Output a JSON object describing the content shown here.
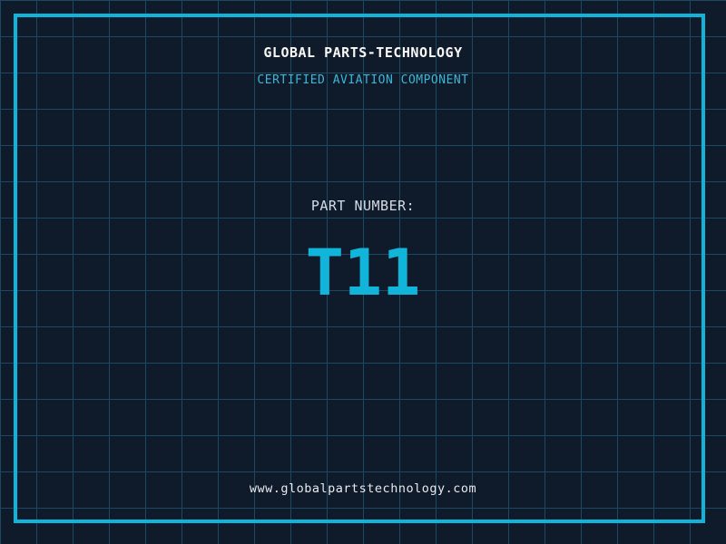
{
  "page": {
    "company_name": "GLOBAL PARTS-TECHNOLOGY",
    "tagline": "CERTIFIED AVIATION COMPONENT",
    "part_label": "PART NUMBER:",
    "part_number": "T11",
    "website": "www.globalpartstechnology.com"
  },
  "colors": {
    "background": "#0f1a2a",
    "grid_line": "#1c4860",
    "frame_accent": "#10b4da",
    "title_text": "#f8f8f8",
    "tagline_text": "#3eb6d6",
    "label_text": "#d6dce4",
    "part_number_color": "#12b5da",
    "website_text": "#e8eaed"
  }
}
